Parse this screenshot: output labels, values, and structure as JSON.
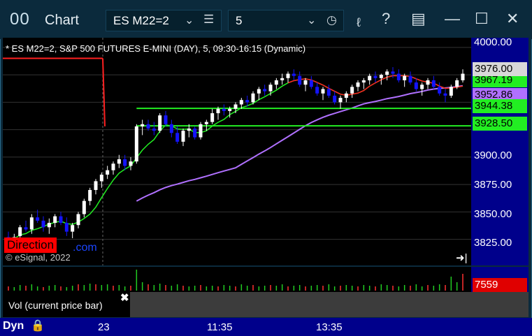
{
  "titlebar": {
    "app_icon": "00",
    "title": "Chart",
    "symbol": "ES M22=2",
    "interval": "5",
    "icons": [
      "dropdown-icon",
      "menu-icon",
      "clock-icon",
      "draw-icon",
      "help-icon",
      "layout-icon",
      "minimize-icon",
      "maximize-icon",
      "close-icon"
    ]
  },
  "chart": {
    "title": "* ES M22=2, S&P 500 FUTURES E-MINI (DAY), 5, 09:30-16:15 (Dynamic)",
    "watermark": "© eSignal, 2022",
    "badge": "Direction",
    "badge_suffix": ".com",
    "colors": {
      "bg": "#000000",
      "up": "#ffffff",
      "down": "#1414ff",
      "ma_fast": "#ff2020",
      "ma_green": "#22ee22",
      "ma_purple": "#b070ff"
    }
  },
  "price_axis": {
    "ticks": [
      "4000.00",
      "3900.00",
      "3875.00",
      "3850.00",
      "3825.00"
    ],
    "labels": [
      {
        "text": "3976.00",
        "bg": "#d8d8d8",
        "fg": "#000000"
      },
      {
        "text": "3967.19",
        "bg": "#22ee22",
        "fg": "#000000"
      },
      {
        "text": "3952.86",
        "bg": "#b070ff",
        "fg": "#000000"
      },
      {
        "text": "3944.38",
        "bg": "#22ee22",
        "fg": "#000000"
      },
      {
        "text": "3928.50",
        "bg": "#22ee22",
        "fg": "#000000"
      }
    ]
  },
  "volume": {
    "label": "Vol (current price bar)",
    "value": "7559"
  },
  "time_axis": {
    "mode": "Dyn",
    "ticks": [
      "23",
      "11:35",
      "13:35"
    ]
  },
  "chart_data": {
    "type": "candlestick",
    "ylim": [
      3805,
      4005
    ],
    "candles": [
      [
        3827,
        3832,
        3822,
        3824
      ],
      [
        3825,
        3830,
        3820,
        3827
      ],
      [
        3828,
        3838,
        3826,
        3836
      ],
      [
        3836,
        3842,
        3832,
        3834
      ],
      [
        3834,
        3848,
        3830,
        3845
      ],
      [
        3845,
        3852,
        3840,
        3842
      ],
      [
        3842,
        3846,
        3832,
        3836
      ],
      [
        3836,
        3844,
        3830,
        3840
      ],
      [
        3840,
        3848,
        3836,
        3846
      ],
      [
        3846,
        3850,
        3838,
        3840
      ],
      [
        3840,
        3845,
        3828,
        3832
      ],
      [
        3832,
        3840,
        3826,
        3838
      ],
      [
        3838,
        3850,
        3835,
        3848
      ],
      [
        3848,
        3862,
        3845,
        3860
      ],
      [
        3860,
        3872,
        3856,
        3870
      ],
      [
        3870,
        3880,
        3866,
        3878
      ],
      [
        3878,
        3886,
        3872,
        3884
      ],
      [
        3884,
        3892,
        3880,
        3888
      ],
      [
        3888,
        3896,
        3884,
        3894
      ],
      [
        3894,
        3902,
        3890,
        3898
      ],
      [
        3898,
        3902,
        3888,
        3892
      ],
      [
        3892,
        3900,
        3888,
        3896
      ],
      [
        3896,
        3930,
        3894,
        3928
      ],
      [
        3928,
        3934,
        3920,
        3930
      ],
      [
        3930,
        3934,
        3924,
        3926
      ],
      [
        3926,
        3932,
        3920,
        3924
      ],
      [
        3924,
        3940,
        3922,
        3938
      ],
      [
        3938,
        3942,
        3928,
        3930
      ],
      [
        3930,
        3934,
        3918,
        3922
      ],
      [
        3922,
        3928,
        3912,
        3914
      ],
      [
        3914,
        3926,
        3910,
        3924
      ],
      [
        3924,
        3930,
        3918,
        3926
      ],
      [
        3926,
        3928,
        3916,
        3918
      ],
      [
        3918,
        3932,
        3916,
        3930
      ],
      [
        3930,
        3934,
        3924,
        3932
      ],
      [
        3932,
        3944,
        3930,
        3940
      ],
      [
        3940,
        3946,
        3934,
        3944
      ],
      [
        3944,
        3948,
        3938,
        3942
      ],
      [
        3942,
        3946,
        3936,
        3944
      ],
      [
        3944,
        3950,
        3940,
        3948
      ],
      [
        3948,
        3954,
        3944,
        3952
      ],
      [
        3952,
        3956,
        3946,
        3950
      ],
      [
        3950,
        3960,
        3948,
        3958
      ],
      [
        3958,
        3964,
        3952,
        3962
      ],
      [
        3962,
        3966,
        3956,
        3960
      ],
      [
        3960,
        3968,
        3956,
        3966
      ],
      [
        3966,
        3972,
        3962,
        3970
      ],
      [
        3970,
        3976,
        3966,
        3972
      ],
      [
        3972,
        3978,
        3968,
        3976
      ],
      [
        3976,
        3980,
        3970,
        3974
      ],
      [
        3974,
        3978,
        3964,
        3966
      ],
      [
        3966,
        3972,
        3960,
        3970
      ],
      [
        3970,
        3974,
        3962,
        3964
      ],
      [
        3964,
        3968,
        3956,
        3958
      ],
      [
        3958,
        3964,
        3952,
        3962
      ],
      [
        3962,
        3966,
        3954,
        3956
      ],
      [
        3956,
        3960,
        3948,
        3950
      ],
      [
        3950,
        3956,
        3944,
        3954
      ],
      [
        3954,
        3960,
        3950,
        3958
      ],
      [
        3958,
        3966,
        3954,
        3964
      ],
      [
        3964,
        3970,
        3960,
        3968
      ],
      [
        3968,
        3972,
        3962,
        3970
      ],
      [
        3970,
        3976,
        3966,
        3974
      ],
      [
        3974,
        3978,
        3968,
        3972
      ],
      [
        3972,
        3976,
        3966,
        3975
      ],
      [
        3975,
        3980,
        3970,
        3978
      ],
      [
        3978,
        3982,
        3972,
        3976
      ],
      [
        3976,
        3980,
        3968,
        3970
      ],
      [
        3970,
        3976,
        3964,
        3974
      ],
      [
        3974,
        3978,
        3966,
        3968
      ],
      [
        3968,
        3972,
        3960,
        3962
      ],
      [
        3962,
        3968,
        3956,
        3966
      ],
      [
        3966,
        3972,
        3962,
        3970
      ],
      [
        3970,
        3974,
        3962,
        3964
      ],
      [
        3964,
        3968,
        3956,
        3958
      ],
      [
        3958,
        3962,
        3950,
        3956
      ],
      [
        3956,
        3966,
        3954,
        3964
      ],
      [
        3964,
        3972,
        3962,
        3970
      ],
      [
        3970,
        3980,
        3968,
        3976
      ]
    ],
    "volume": [
      6,
      5,
      8,
      7,
      9,
      6,
      5,
      7,
      8,
      6,
      5,
      7,
      9,
      8,
      10,
      9,
      8,
      9,
      7,
      8,
      6,
      7,
      30,
      12,
      9,
      8,
      10,
      8,
      7,
      9,
      7,
      6,
      7,
      8,
      6,
      7,
      6,
      8,
      7,
      6,
      9,
      7,
      8,
      6,
      7,
      8,
      7,
      9,
      6,
      7,
      8,
      6,
      7,
      8,
      7,
      9,
      6,
      7,
      8,
      7,
      6,
      8,
      7,
      6,
      9,
      8,
      7,
      6,
      8,
      7,
      9,
      6,
      8,
      7,
      9,
      8,
      20,
      12,
      24
    ]
  }
}
